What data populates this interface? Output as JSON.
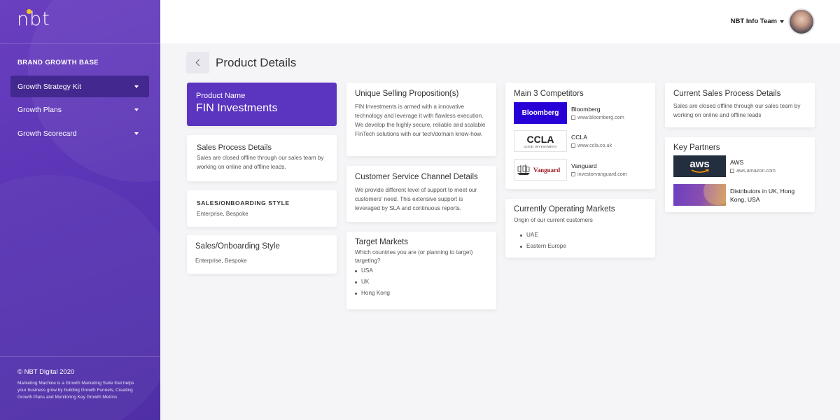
{
  "sidebar": {
    "logo": "nbt",
    "heading": "BRAND GROWTH BASE",
    "items": [
      {
        "label": "Growth Strategy Kit",
        "active": true
      },
      {
        "label": "Growth Plans",
        "active": false
      },
      {
        "label": "Growth Scorecard",
        "active": false
      }
    ],
    "copyright": "© NBT Digital 2020",
    "description": "Marketing Machine is a Growth Marketing Suite that helps your business grow by building Growth Funnels, Creating Growth Plans and Monitoring Key Growth Metrics"
  },
  "header": {
    "user_name": "NBT Info Team"
  },
  "page": {
    "title": "Product Details"
  },
  "product": {
    "label": "Product Name",
    "name": "FIN Investments"
  },
  "sales_process": {
    "title": "Sales Process Details",
    "text": "Sales are closed offline through our sales team by working on online and offline leads."
  },
  "onboarding_small": {
    "title": "SALES/ONBOARDING STYLE",
    "text": "Enterprise, Bespoke"
  },
  "onboarding_large": {
    "title": "Sales/Onboarding Style",
    "text": "Enterprise, Bespoke"
  },
  "usp": {
    "title": "Unique Selling Proposition(s)",
    "text": "FIN Investments is armed with a innovative technology and leverage it with flawless execution. We develop the highly secure, reliable and scalable FinTech solutions with our tech/domain know-how."
  },
  "customer_service": {
    "title": "Customer Service Channel Details",
    "text": "We provide different level of support to meet our customers' need. This extensive support is leveraged by SLA and continuous reports."
  },
  "target_markets": {
    "title": "Target Markets",
    "subtitle": "Which countries you are (or planning to target) targeting?",
    "items": [
      "USA",
      "UK",
      "Hong Kong"
    ]
  },
  "competitors": {
    "title": "Main 3 Competitors",
    "items": [
      {
        "logo_text": "Bloomberg",
        "name": "Bloomberg",
        "url": "www.bloomberg.com"
      },
      {
        "logo_text": "CCLA",
        "logo_sub": "GOOD INVESTMENT",
        "name": "CCLA",
        "url": "www.ccla.co.uk"
      },
      {
        "logo_text": "Vanguard",
        "name": "Vanguard",
        "url": "investorvanguard.com"
      }
    ]
  },
  "operating_markets": {
    "title": "Currently Operating Markets",
    "subtitle": "Origin of our current customers",
    "items": [
      "UAE",
      "Eastern Europe"
    ]
  },
  "current_sales": {
    "title": "Current Sales Process Details",
    "text": "Sales are closed offline through our sales team by working on online and offline leads"
  },
  "partners": {
    "title": "Key Partners",
    "items": [
      {
        "logo_text": "aws",
        "name": "AWS",
        "url": "aws.amazon.com"
      },
      {
        "name": "Distributors in UK, Hong Kong, USA"
      }
    ]
  },
  "colors": {
    "brand_purple": "#5b34c0",
    "sidebar_active": "#43288f",
    "bloomberg_blue": "#2800d7",
    "aws_dark": "#232f3e",
    "aws_orange": "#ff9900",
    "vanguard_red": "#96151d"
  }
}
